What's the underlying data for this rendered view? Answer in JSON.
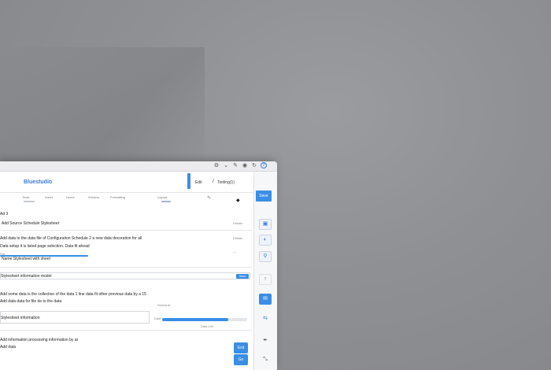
{
  "window": {
    "title_icons": [
      "settings-icon",
      "chevron-down-icon",
      "pencil-icon",
      "eye-icon",
      "refresh-icon",
      "help-icon"
    ]
  },
  "header": {
    "title": "Bluestudio",
    "text_1": "Edit",
    "text_2": "Tooling(1)"
  },
  "toolbar": {
    "items": [
      "Tools",
      "Insert",
      "Home",
      "Window",
      "Formatting",
      "Layout"
    ]
  },
  "content": {
    "heading": "Ad 3",
    "line_1": "Add Source Schedule Stylesheet",
    "line_1_note": "Details",
    "line_2": "Add data to the data file of Configuration Schedule 2 a new data decoration for all",
    "line_2_note": "Details",
    "line_3": "Data setup it is listed page selection. Data fit ahead",
    "line_4": "File",
    "line_5": "Name Stylesheet with sheet",
    "field_1_label": "Stylesheet information model",
    "field_1_button": "Save",
    "line_6": "Add some data is the collection of the data 1 line data fit other previous data by a 15",
    "line_7": "Add data data for file de to the data",
    "line_7_note": "Schedule",
    "field_2_label": "Stylesheet information",
    "progress_label": "Data",
    "progress_note": "Data 100",
    "progress_value": 0.78,
    "footer_1": "Add information processing information by at",
    "footer_2": "Add data"
  },
  "sidebar": {
    "top_label": "Save",
    "action_1": "Exit",
    "action_2": "Go"
  }
}
